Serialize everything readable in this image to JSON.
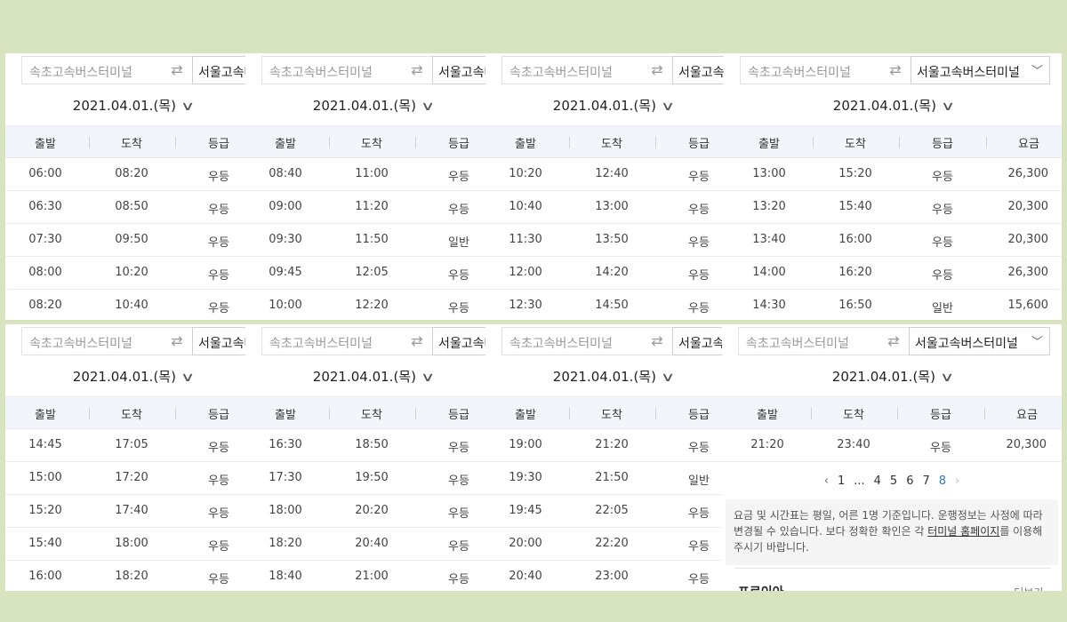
{
  "route": {
    "from_placeholder": "속초고속버스터미널",
    "swap_icon": "⇄",
    "to": "서울고속버스터미널",
    "chevron_icon": "chevron-down-icon"
  },
  "date": "2021.04.01.(목)",
  "headers": [
    "출발",
    "도착",
    "등급",
    "요금"
  ],
  "top": {
    "panel1": [
      [
        "06:00",
        "08:20",
        "우등"
      ],
      [
        "06:30",
        "08:50",
        "우등"
      ],
      [
        "07:30",
        "09:50",
        "우등"
      ],
      [
        "08:00",
        "10:20",
        "우등"
      ],
      [
        "08:20",
        "10:40",
        "우등"
      ]
    ],
    "panel2": [
      [
        "08:40",
        "11:00",
        "우등"
      ],
      [
        "09:00",
        "11:20",
        "우등"
      ],
      [
        "09:30",
        "11:50",
        "일반"
      ],
      [
        "09:45",
        "12:05",
        "우등"
      ],
      [
        "10:00",
        "12:20",
        "우등"
      ]
    ],
    "panel3": [
      [
        "10:20",
        "12:40",
        "우등"
      ],
      [
        "10:40",
        "13:00",
        "우등"
      ],
      [
        "11:30",
        "13:50",
        "우등"
      ],
      [
        "12:00",
        "14:20",
        "우등"
      ],
      [
        "12:30",
        "14:50",
        "우등"
      ]
    ],
    "panel4": [
      [
        "13:00",
        "15:20",
        "우등",
        "26,300"
      ],
      [
        "13:20",
        "15:40",
        "우등",
        "20,300"
      ],
      [
        "13:40",
        "16:00",
        "우등",
        "20,300"
      ],
      [
        "14:00",
        "16:20",
        "우등",
        "26,300"
      ],
      [
        "14:30",
        "16:50",
        "일반",
        "15,600"
      ]
    ]
  },
  "bottom": {
    "panel1": [
      [
        "14:45",
        "17:05",
        "우등"
      ],
      [
        "15:00",
        "17:20",
        "우등"
      ],
      [
        "15:20",
        "17:40",
        "우등"
      ],
      [
        "15:40",
        "18:00",
        "우등"
      ],
      [
        "16:00",
        "18:20",
        "우등"
      ]
    ],
    "panel2": [
      [
        "16:30",
        "18:50",
        "우등"
      ],
      [
        "17:30",
        "19:50",
        "우등"
      ],
      [
        "18:00",
        "20:20",
        "우등"
      ],
      [
        "18:20",
        "20:40",
        "우등"
      ],
      [
        "18:40",
        "21:00",
        "우등"
      ]
    ],
    "panel3": [
      [
        "19:00",
        "21:20",
        "우등"
      ],
      [
        "19:30",
        "21:50",
        "일반"
      ],
      [
        "19:45",
        "22:05",
        "우등"
      ],
      [
        "20:00",
        "22:20",
        "우등"
      ],
      [
        "20:40",
        "23:00",
        "우등"
      ]
    ],
    "panel4": [
      [
        "21:20",
        "23:40",
        "우등",
        "20,300"
      ]
    ]
  },
  "pagination": {
    "prev": "‹",
    "pages": [
      "1",
      "...",
      "4",
      "5",
      "6",
      "7",
      "8"
    ],
    "active": "8",
    "next": "›"
  },
  "notice": {
    "text_before": "요금 및 시간표는 평일, 어른 1명 기준입니다. 운행정보는 사정에 따라 변경될 수 있습니다. 보다 정확한 확인은 각 ",
    "link": "터미널 홈페이지",
    "text_after": "를 이용해 주시기 바랍니다."
  },
  "tips": {
    "title": "프로이아",
    "more": "더보기 ›"
  }
}
